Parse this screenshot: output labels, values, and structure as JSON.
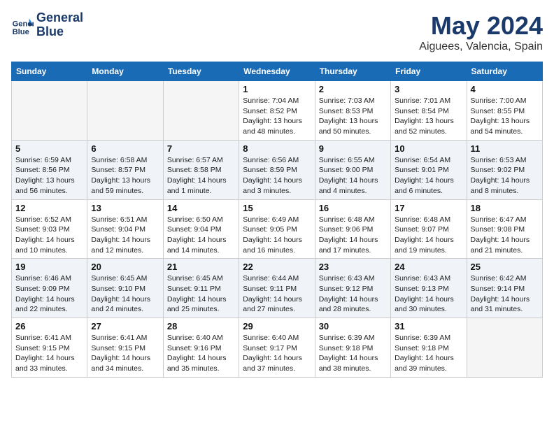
{
  "header": {
    "logo_line1": "General",
    "logo_line2": "Blue",
    "month": "May 2024",
    "location": "Aiguees, Valencia, Spain"
  },
  "weekdays": [
    "Sunday",
    "Monday",
    "Tuesday",
    "Wednesday",
    "Thursday",
    "Friday",
    "Saturday"
  ],
  "weeks": [
    [
      {
        "day": "",
        "empty": true
      },
      {
        "day": "",
        "empty": true
      },
      {
        "day": "",
        "empty": true
      },
      {
        "day": "1",
        "sunrise": "7:04 AM",
        "sunset": "8:52 PM",
        "daylight": "13 hours and 48 minutes."
      },
      {
        "day": "2",
        "sunrise": "7:03 AM",
        "sunset": "8:53 PM",
        "daylight": "13 hours and 50 minutes."
      },
      {
        "day": "3",
        "sunrise": "7:01 AM",
        "sunset": "8:54 PM",
        "daylight": "13 hours and 52 minutes."
      },
      {
        "day": "4",
        "sunrise": "7:00 AM",
        "sunset": "8:55 PM",
        "daylight": "13 hours and 54 minutes."
      }
    ],
    [
      {
        "day": "5",
        "sunrise": "6:59 AM",
        "sunset": "8:56 PM",
        "daylight": "13 hours and 56 minutes."
      },
      {
        "day": "6",
        "sunrise": "6:58 AM",
        "sunset": "8:57 PM",
        "daylight": "13 hours and 59 minutes."
      },
      {
        "day": "7",
        "sunrise": "6:57 AM",
        "sunset": "8:58 PM",
        "daylight": "14 hours and 1 minute."
      },
      {
        "day": "8",
        "sunrise": "6:56 AM",
        "sunset": "8:59 PM",
        "daylight": "14 hours and 3 minutes."
      },
      {
        "day": "9",
        "sunrise": "6:55 AM",
        "sunset": "9:00 PM",
        "daylight": "14 hours and 4 minutes."
      },
      {
        "day": "10",
        "sunrise": "6:54 AM",
        "sunset": "9:01 PM",
        "daylight": "14 hours and 6 minutes."
      },
      {
        "day": "11",
        "sunrise": "6:53 AM",
        "sunset": "9:02 PM",
        "daylight": "14 hours and 8 minutes."
      }
    ],
    [
      {
        "day": "12",
        "sunrise": "6:52 AM",
        "sunset": "9:03 PM",
        "daylight": "14 hours and 10 minutes."
      },
      {
        "day": "13",
        "sunrise": "6:51 AM",
        "sunset": "9:04 PM",
        "daylight": "14 hours and 12 minutes."
      },
      {
        "day": "14",
        "sunrise": "6:50 AM",
        "sunset": "9:04 PM",
        "daylight": "14 hours and 14 minutes."
      },
      {
        "day": "15",
        "sunrise": "6:49 AM",
        "sunset": "9:05 PM",
        "daylight": "14 hours and 16 minutes."
      },
      {
        "day": "16",
        "sunrise": "6:48 AM",
        "sunset": "9:06 PM",
        "daylight": "14 hours and 17 minutes."
      },
      {
        "day": "17",
        "sunrise": "6:48 AM",
        "sunset": "9:07 PM",
        "daylight": "14 hours and 19 minutes."
      },
      {
        "day": "18",
        "sunrise": "6:47 AM",
        "sunset": "9:08 PM",
        "daylight": "14 hours and 21 minutes."
      }
    ],
    [
      {
        "day": "19",
        "sunrise": "6:46 AM",
        "sunset": "9:09 PM",
        "daylight": "14 hours and 22 minutes."
      },
      {
        "day": "20",
        "sunrise": "6:45 AM",
        "sunset": "9:10 PM",
        "daylight": "14 hours and 24 minutes."
      },
      {
        "day": "21",
        "sunrise": "6:45 AM",
        "sunset": "9:11 PM",
        "daylight": "14 hours and 25 minutes."
      },
      {
        "day": "22",
        "sunrise": "6:44 AM",
        "sunset": "9:11 PM",
        "daylight": "14 hours and 27 minutes."
      },
      {
        "day": "23",
        "sunrise": "6:43 AM",
        "sunset": "9:12 PM",
        "daylight": "14 hours and 28 minutes."
      },
      {
        "day": "24",
        "sunrise": "6:43 AM",
        "sunset": "9:13 PM",
        "daylight": "14 hours and 30 minutes."
      },
      {
        "day": "25",
        "sunrise": "6:42 AM",
        "sunset": "9:14 PM",
        "daylight": "14 hours and 31 minutes."
      }
    ],
    [
      {
        "day": "26",
        "sunrise": "6:41 AM",
        "sunset": "9:15 PM",
        "daylight": "14 hours and 33 minutes."
      },
      {
        "day": "27",
        "sunrise": "6:41 AM",
        "sunset": "9:15 PM",
        "daylight": "14 hours and 34 minutes."
      },
      {
        "day": "28",
        "sunrise": "6:40 AM",
        "sunset": "9:16 PM",
        "daylight": "14 hours and 35 minutes."
      },
      {
        "day": "29",
        "sunrise": "6:40 AM",
        "sunset": "9:17 PM",
        "daylight": "14 hours and 37 minutes."
      },
      {
        "day": "30",
        "sunrise": "6:39 AM",
        "sunset": "9:18 PM",
        "daylight": "14 hours and 38 minutes."
      },
      {
        "day": "31",
        "sunrise": "6:39 AM",
        "sunset": "9:18 PM",
        "daylight": "14 hours and 39 minutes."
      },
      {
        "day": "",
        "empty": true
      }
    ]
  ],
  "labels": {
    "sunrise": "Sunrise:",
    "sunset": "Sunset:",
    "daylight": "Daylight hours"
  }
}
